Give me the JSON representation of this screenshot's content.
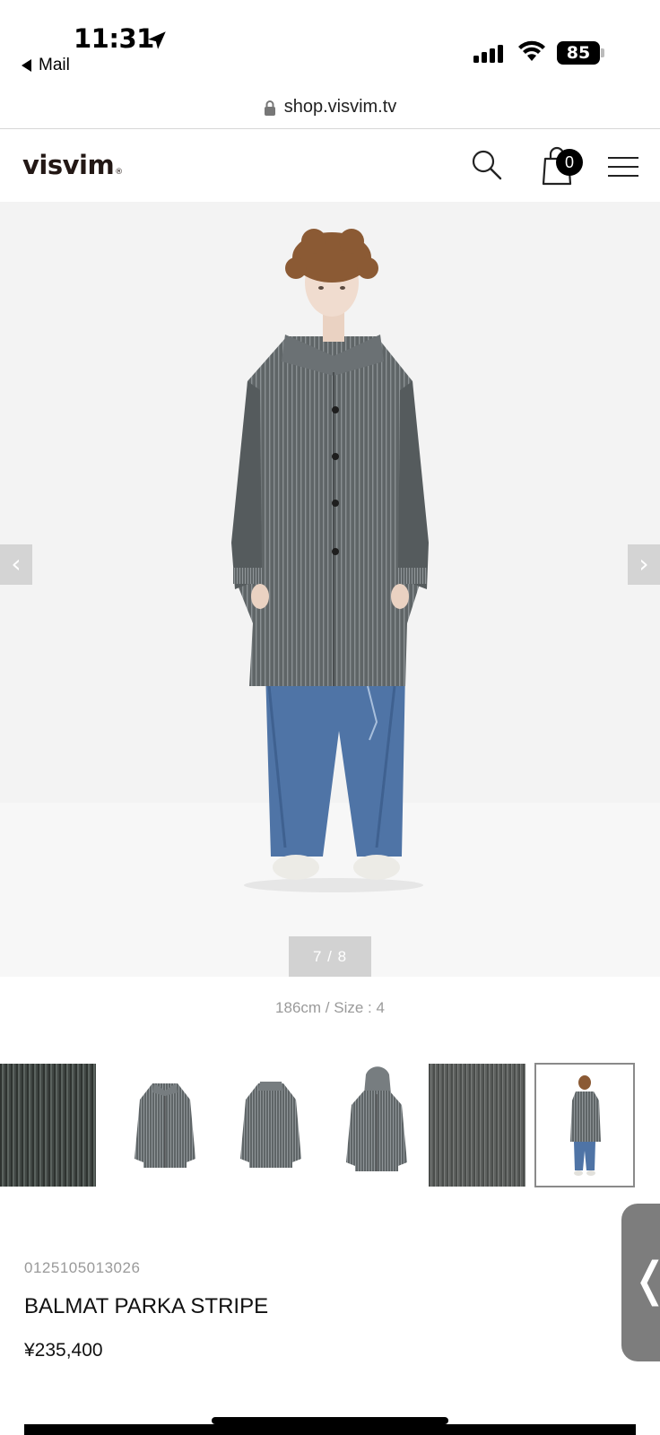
{
  "status_bar": {
    "time": "11:31",
    "back_app": "Mail",
    "battery": "85"
  },
  "browser": {
    "url": "shop.visvim.tv"
  },
  "header": {
    "logo": "visvim",
    "logo_mark": "®",
    "cart_count": "0"
  },
  "gallery": {
    "counter": "7 / 8",
    "caption": "186cm / Size : 4",
    "prev_glyph": "‹",
    "next_glyph": "›",
    "thumbnails": [
      {
        "name": "fabric-closeup"
      },
      {
        "name": "coat-front"
      },
      {
        "name": "coat-back"
      },
      {
        "name": "coat-hooded"
      },
      {
        "name": "fabric-texture"
      },
      {
        "name": "model-full-body"
      }
    ],
    "active_thumbnail": 6
  },
  "product": {
    "sku": "0125105013026",
    "name": "BALMAT PARKA STRIPE",
    "price": "¥235,400"
  },
  "side_tab": {
    "glyph": "❬"
  },
  "colors": {
    "coat": "#5f6567",
    "jeans": "#4f74a6",
    "hair": "#8b5a34",
    "badge": "#000000"
  }
}
